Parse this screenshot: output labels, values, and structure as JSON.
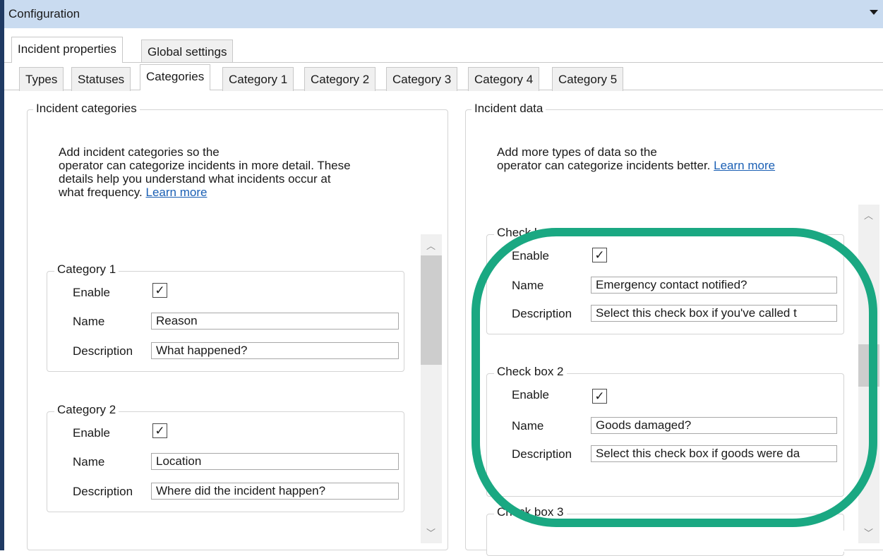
{
  "window": {
    "title": "Configuration"
  },
  "tabs_top": [
    "Incident properties",
    "Global settings"
  ],
  "tabs_sub": [
    "Types",
    "Statuses",
    "Categories",
    "Category 1",
    "Category 2",
    "Category 3",
    "Category 4",
    "Category 5"
  ],
  "left": {
    "title": "Incident categories",
    "help": "Add incident categories so the operator can categorize incidents in more detail. These details help you understand what incidents occur at what frequency.",
    "help_line1": "Add incident categories so the",
    "help_line2": "operator can categorize incidents in more detail. These",
    "help_line3": "details help you understand what incidents occur at",
    "help_line4": "what frequency.",
    "learn_more": "Learn more",
    "groups": [
      {
        "title": "Category 1",
        "enable_label": "Enable",
        "enabled": true,
        "name_label": "Name",
        "name": "Reason",
        "description_label": "Description",
        "description": "What happened?"
      },
      {
        "title": "Category 2",
        "enable_label": "Enable",
        "enabled": true,
        "name_label": "Name",
        "name": "Location",
        "description_label": "Description",
        "description": "Where did the incident happen?"
      }
    ]
  },
  "right": {
    "title": "Incident data",
    "help_line1": "Add more types of data so the",
    "help_line2": "operator can categorize incidents better.",
    "learn_more": "Learn more",
    "groups": [
      {
        "title": "Check box 1",
        "enable_label": "Enable",
        "enabled": true,
        "name_label": "Name",
        "name": "Emergency contact notified?",
        "description_label": "Description",
        "description": "Select this check box if you've called t"
      },
      {
        "title": "Check box 2",
        "enable_label": "Enable",
        "enabled": true,
        "name_label": "Name",
        "name": "Goods damaged?",
        "description_label": "Description",
        "description": "Select this check box if goods were da"
      },
      {
        "title": "Check box 3"
      }
    ]
  },
  "checkmark": "✓",
  "colors": {
    "titlebar": "#c9dbf0",
    "highlight": "#1aa882",
    "link": "#1a5fb4"
  }
}
